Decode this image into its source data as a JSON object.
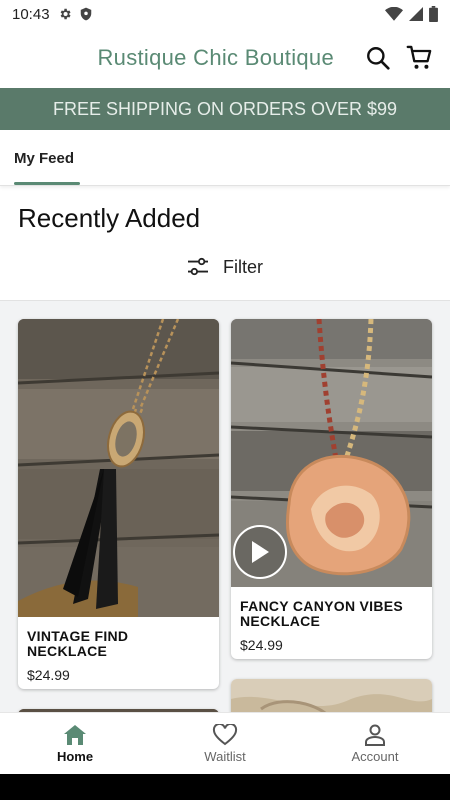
{
  "status_bar": {
    "time": "10:43",
    "icons": [
      "gear-icon",
      "shield-icon",
      "wifi-icon",
      "signal-icon",
      "battery-icon"
    ]
  },
  "header": {
    "brand": "Rustique Chic Boutique",
    "icons": [
      "search-icon",
      "cart-icon"
    ],
    "brand_color": "#5a8a74"
  },
  "promo": {
    "text": "FREE SHIPPING ON ORDERS OVER $99",
    "bg_color": "#5a7a6a"
  },
  "tabs": [
    {
      "label": "My Feed",
      "active": true
    }
  ],
  "section": {
    "title": "Recently Added",
    "filter_label": "Filter"
  },
  "products": [
    {
      "name": "VINTAGE FIND NECKLACE",
      "price": "$24.99",
      "has_video": false
    },
    {
      "name": "FANCY CANYON VIBES NECKLACE",
      "price": "$24.99",
      "has_video": true
    }
  ],
  "bottom_nav": [
    {
      "label": "Home",
      "icon": "home-icon",
      "active": true
    },
    {
      "label": "Waitlist",
      "icon": "heart-icon",
      "active": false
    },
    {
      "label": "Account",
      "icon": "account-icon",
      "active": false
    }
  ]
}
